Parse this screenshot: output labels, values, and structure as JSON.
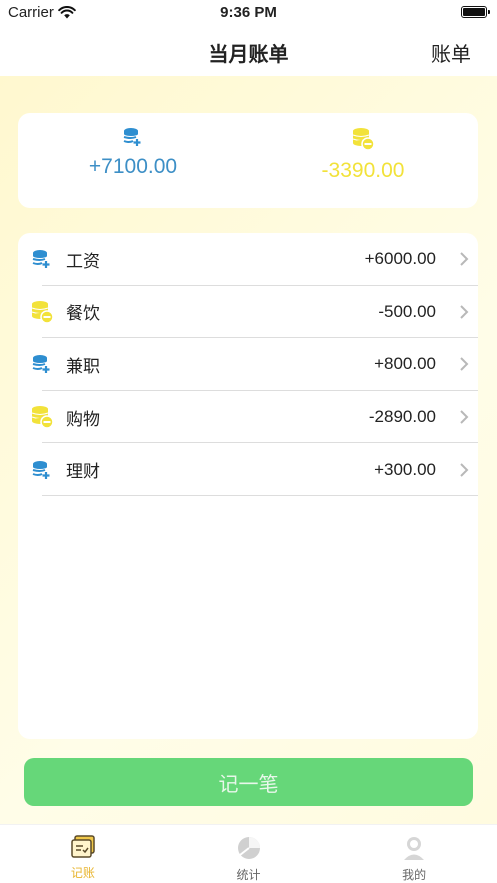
{
  "status_bar": {
    "carrier": "Carrier",
    "time": "9:36 PM"
  },
  "nav": {
    "title": "当月账单",
    "right_label": "账单"
  },
  "summary": {
    "income": {
      "amount": "+7100.00",
      "icon": "coin-stack-plus-icon",
      "color": "#3d8fc6"
    },
    "expense": {
      "amount": "-3390.00",
      "icon": "coin-stack-minus-icon",
      "color": "#f2e23a"
    }
  },
  "items": [
    {
      "label": "工资",
      "amount": "+6000.00",
      "type": "income"
    },
    {
      "label": "餐饮",
      "amount": "-500.00",
      "type": "expense"
    },
    {
      "label": "兼职",
      "amount": "+800.00",
      "type": "income"
    },
    {
      "label": "购物",
      "amount": "-2890.00",
      "type": "expense"
    },
    {
      "label": "理财",
      "amount": "+300.00",
      "type": "income"
    }
  ],
  "record_button": {
    "label": "记一笔"
  },
  "tabs": [
    {
      "label": "记账",
      "icon": "ledger-icon",
      "active": true
    },
    {
      "label": "统计",
      "icon": "chart-icon",
      "active": false
    },
    {
      "label": "我的",
      "icon": "profile-icon",
      "active": false
    }
  ],
  "colors": {
    "accent": "#e8b530",
    "button": "#66d779",
    "background": "#fff8cf"
  }
}
